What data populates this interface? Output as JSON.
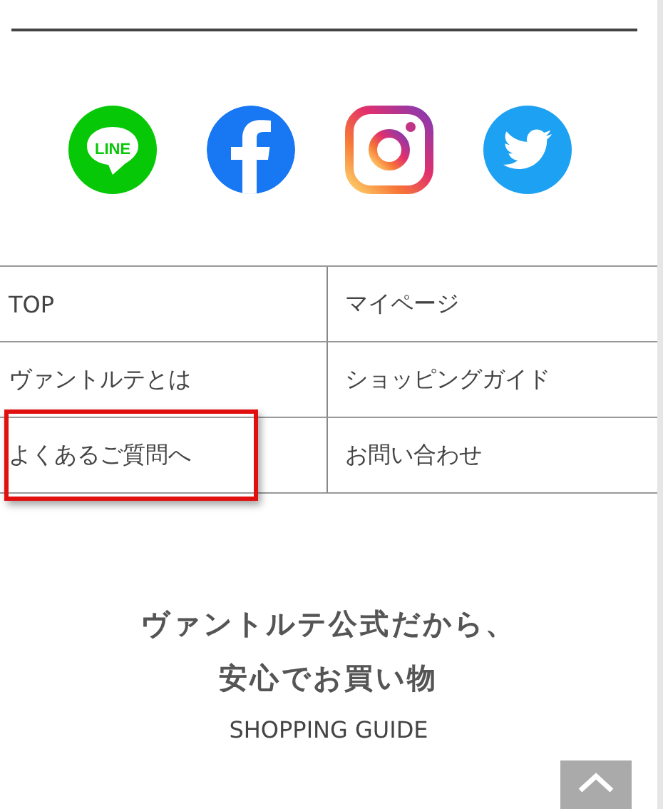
{
  "social_links": [
    {
      "kind": "line",
      "label": "LINE"
    },
    {
      "kind": "facebook"
    },
    {
      "kind": "instagram"
    },
    {
      "kind": "twitter"
    }
  ],
  "nav_links": [
    {
      "label": "TOP",
      "highlighted": false
    },
    {
      "label": "マイページ",
      "highlighted": false
    },
    {
      "label": "ヴァントルテとは",
      "highlighted": false
    },
    {
      "label": "ショッピングガイド",
      "highlighted": false
    },
    {
      "label": "よくあるご質問へ",
      "highlighted": true
    },
    {
      "label": "お問い合わせ",
      "highlighted": false
    }
  ],
  "promo": {
    "heading_lines": [
      "ヴァントルテ公式だから、",
      "安心でお買い物"
    ],
    "subtitle": "SHOPPING GUIDE"
  }
}
